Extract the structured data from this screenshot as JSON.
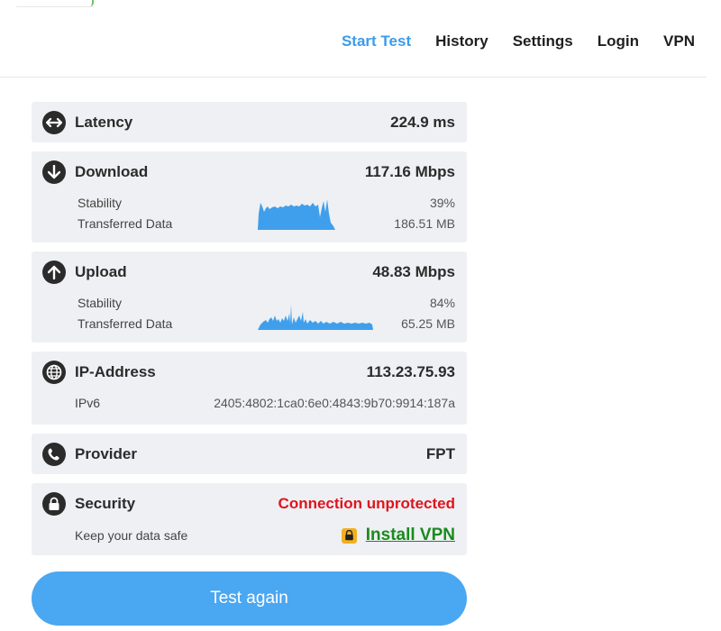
{
  "nav": {
    "items": [
      {
        "label": "Start Test",
        "active": true
      },
      {
        "label": "History",
        "active": false
      },
      {
        "label": "Settings",
        "active": false
      },
      {
        "label": "Login",
        "active": false
      },
      {
        "label": "VPN",
        "active": false
      }
    ]
  },
  "latency": {
    "label": "Latency",
    "value": "224.9 ms",
    "icon": "arrows-horizontal-icon"
  },
  "download": {
    "label": "Download",
    "value": "117.16 Mbps",
    "icon": "arrow-down-icon",
    "stability_label": "Stability",
    "stability_value": "39%",
    "transferred_label": "Transferred Data",
    "transferred_value": "186.51 MB"
  },
  "upload": {
    "label": "Upload",
    "value": "48.83 Mbps",
    "icon": "arrow-up-icon",
    "stability_label": "Stability",
    "stability_value": "84%",
    "transferred_label": "Transferred Data",
    "transferred_value": "65.25 MB"
  },
  "ip": {
    "label": "IP-Address",
    "value": "113.23.75.93",
    "icon": "globe-icon",
    "ipv6_label": "IPv6",
    "ipv6_value": "2405:4802:1ca0:6e0:4843:9b70:9914:187a"
  },
  "provider": {
    "label": "Provider",
    "value": "FPT",
    "icon": "phone-icon"
  },
  "security": {
    "label": "Security",
    "value": "Connection unprotected",
    "icon": "lock-icon",
    "sub_label": "Keep your data safe",
    "link_label": "Install VPN"
  },
  "action": {
    "test_again_label": "Test again"
  },
  "colors": {
    "accent": "#3d9be9",
    "graph": "#3f9fec",
    "danger": "#e0141e",
    "vpn": "#1a8a1f"
  }
}
